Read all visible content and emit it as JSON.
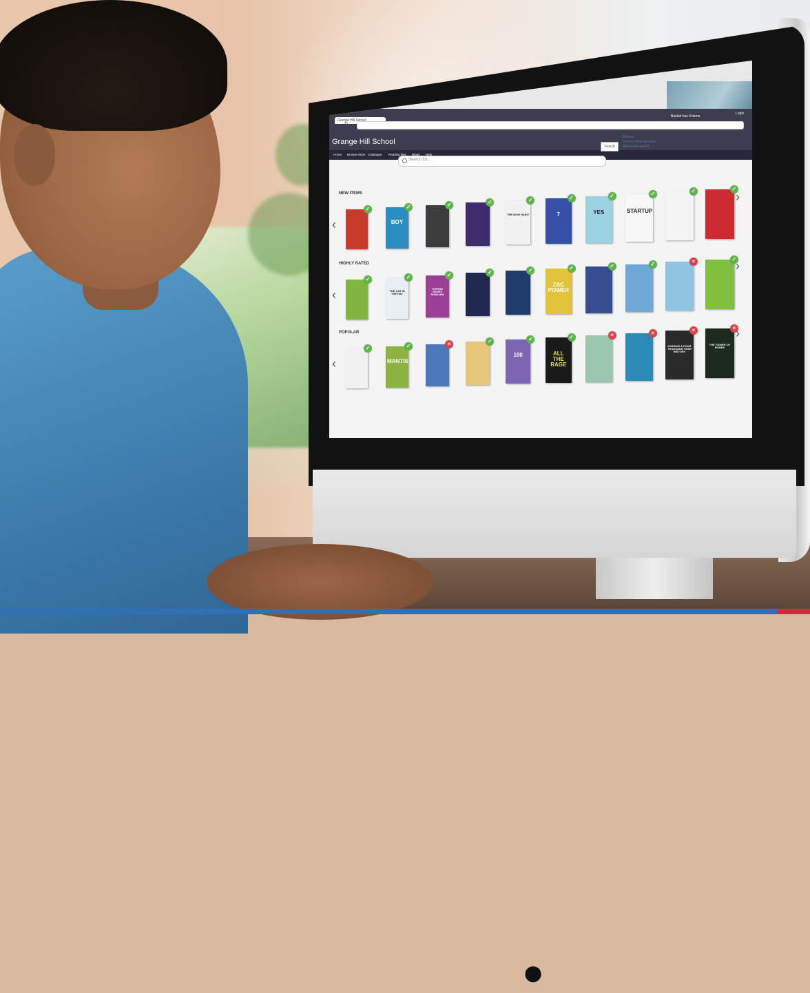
{
  "browser": {
    "tab_label": "Grange Hill School",
    "nav_icons": "← → ↻"
  },
  "site": {
    "title": "Grange Hill School",
    "basket": "Basket has 0 items",
    "login": "Login",
    "nav": [
      "Home",
      "Browse More",
      "Catalogue",
      "Reading lists",
      "Blogs",
      "Help"
    ],
    "search_placeholder": "Search for...",
    "search_button": "Search",
    "side_links": [
      "Browse",
      "Search other sources",
      "Advanced search"
    ]
  },
  "rows": [
    {
      "label": "NEW ITEMS",
      "books": [
        {
          "title": "",
          "color": "#c83a2b",
          "status": "available"
        },
        {
          "title": "BOY",
          "color": "#2a8ec2",
          "status": "available"
        },
        {
          "title": "",
          "color": "#3c3c3c",
          "status": "available"
        },
        {
          "title": "",
          "color": "#3e2c6e",
          "status": "available"
        },
        {
          "title": "THE NOW HABIT",
          "color": "#f1f1f1",
          "status": "available"
        },
        {
          "title": "7",
          "color": "#3550a6",
          "status": "available"
        },
        {
          "title": "YES",
          "color": "#9bd2e0",
          "status": "available"
        },
        {
          "title": "STARTUP",
          "color": "#f7f7f7",
          "status": "available"
        },
        {
          "title": "",
          "color": "#f4f4f4",
          "status": "available"
        },
        {
          "title": "",
          "color": "#cc2b32",
          "status": "available"
        }
      ]
    },
    {
      "label": "HIGHLY RATED",
      "books": [
        {
          "title": "",
          "color": "#7fb540",
          "status": "available"
        },
        {
          "title": "THE CAT IN THE HAT",
          "color": "#e8eef4",
          "status": "available"
        },
        {
          "title": "HORRID HENRY ROWLING",
          "color": "#9b3f94",
          "status": "available"
        },
        {
          "title": "",
          "color": "#20284f",
          "status": "available"
        },
        {
          "title": "",
          "color": "#1f3c6d",
          "status": "available"
        },
        {
          "title": "ZAC POWER",
          "color": "#e2c33c",
          "status": "available"
        },
        {
          "title": "",
          "color": "#364d8f",
          "status": "available"
        },
        {
          "title": "",
          "color": "#6fa7d9",
          "status": "available"
        },
        {
          "title": "",
          "color": "#8fc4e2",
          "status": "unavailable"
        },
        {
          "title": "",
          "color": "#80bf3f",
          "status": "available"
        }
      ]
    },
    {
      "label": "POPULAR",
      "books": [
        {
          "title": "",
          "color": "#f1f1f1",
          "status": "available"
        },
        {
          "title": "MANTIS",
          "color": "#8cb23f",
          "status": "available"
        },
        {
          "title": "",
          "color": "#4b78b8",
          "status": "unavailable"
        },
        {
          "title": "",
          "color": "#e6c779",
          "status": "available"
        },
        {
          "title": "100",
          "color": "#7c66b3",
          "status": "available"
        },
        {
          "title": "ALL THE RAGE",
          "color": "#1a1a1a",
          "status": "available"
        },
        {
          "title": "",
          "color": "#9bc6b0",
          "status": "unavailable"
        },
        {
          "title": "",
          "color": "#2c8ab8",
          "status": "unavailable"
        },
        {
          "title": "SCIENCE A FOUR THOUSAND YEAR HISTORY",
          "color": "#2a2a2a",
          "status": "unavailable"
        },
        {
          "title": "THE TOWER OF BONES",
          "color": "#1c2a20",
          "status": "unavailable"
        }
      ]
    }
  ],
  "colors": {
    "header": "#3c3d4f",
    "nav": "#27283a",
    "available": "#5fb54b",
    "unavailable": "#e0404a",
    "bottom_bar": "#2f6fb6",
    "bottom_accent": "#d7263d"
  },
  "icons": {
    "available": "check-icon",
    "unavailable": "cross-icon",
    "prev": "chevron-left-icon",
    "next": "chevron-right-icon",
    "logo": "apple-logo-icon"
  }
}
